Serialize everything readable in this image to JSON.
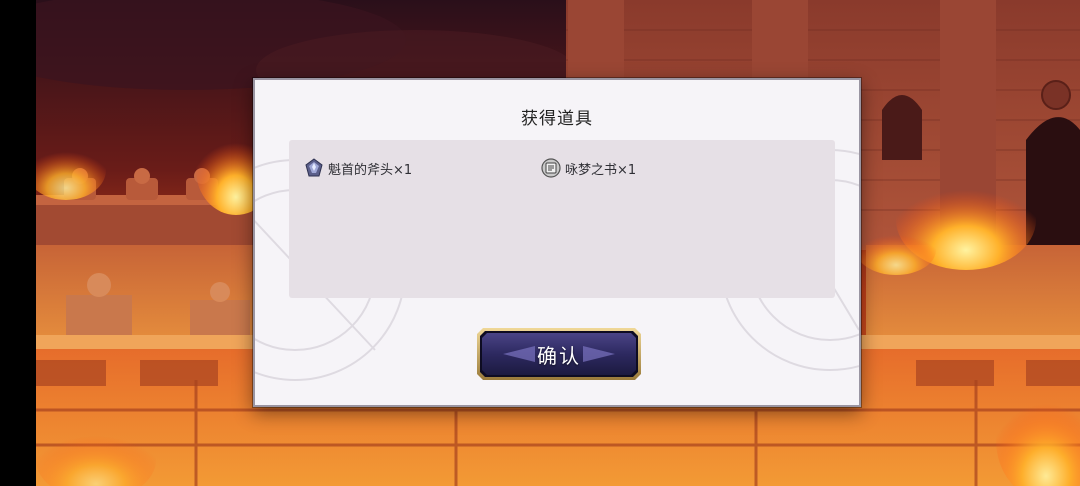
{
  "dialog": {
    "title": "获得道具",
    "confirm_label": "确认"
  },
  "items": [
    {
      "name": "魁首的斧头×1",
      "icon": "axe-head-icon"
    },
    {
      "name": "咏梦之书×1",
      "icon": "dream-book-icon"
    }
  ],
  "colors": {
    "dialog_bg": "#f6f4f8",
    "panel_bg": "#e6e0e6",
    "button_fill": "#2e2a5e",
    "button_border": "#c9ab6a",
    "fire": "#ff6a1e"
  }
}
